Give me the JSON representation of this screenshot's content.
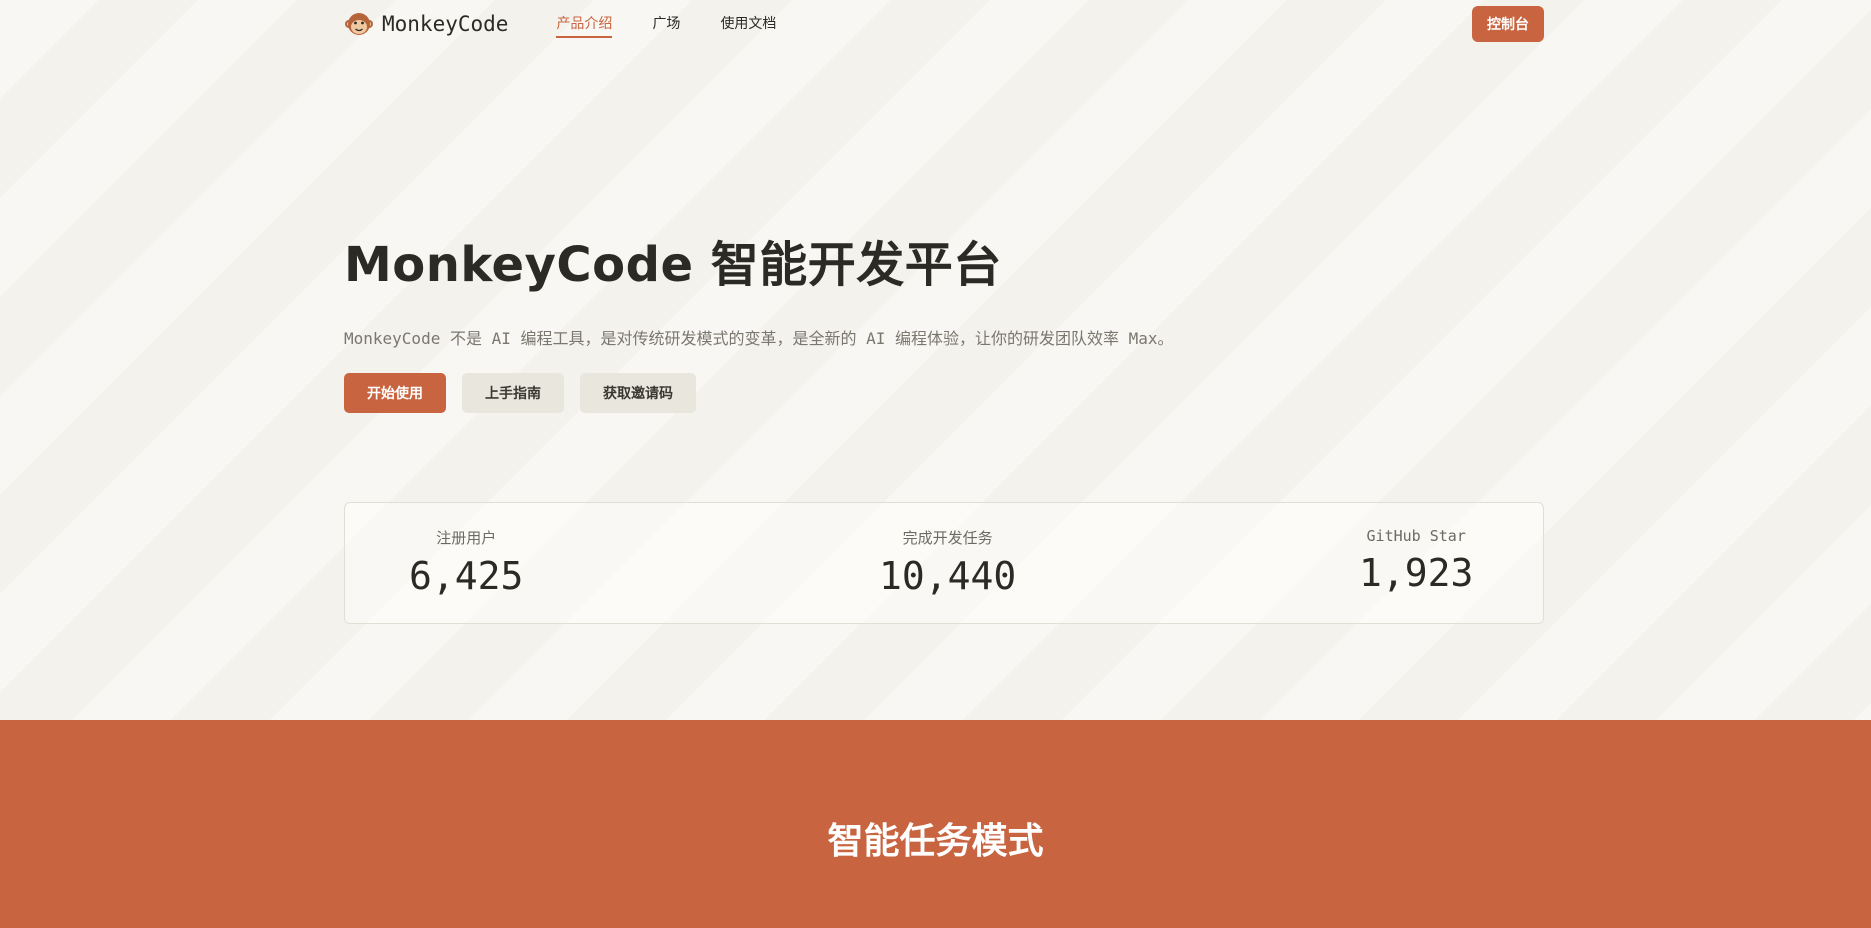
{
  "nav": {
    "logo_text": "MonkeyCode",
    "links": [
      {
        "label": "产品介绍",
        "active": true
      },
      {
        "label": "广场",
        "active": false
      },
      {
        "label": "使用文档",
        "active": false
      }
    ],
    "console_label": "控制台"
  },
  "hero": {
    "title": "MonkeyCode 智能开发平台",
    "subtitle": "MonkeyCode 不是 AI 编程工具，是对传统研发模式的变革，是全新的 AI 编程体验，让你的研发团队效率 Max。",
    "buttons": {
      "start": "开始使用",
      "guide": "上手指南",
      "invite": "获取邀请码"
    }
  },
  "stats": [
    {
      "label": "注册用户",
      "value": "6,425"
    },
    {
      "label": "完成开发任务",
      "value": "10,440"
    },
    {
      "label": "GitHub Star",
      "value": "1,923"
    }
  ],
  "feature": {
    "title": "智能任务模式"
  },
  "colors": {
    "accent": "#c8643f",
    "background": "#f9f7f3",
    "text": "#2b2a24",
    "secondary_button": "#e8e6dd"
  },
  "icons": {
    "logo": "monkey-icon"
  }
}
